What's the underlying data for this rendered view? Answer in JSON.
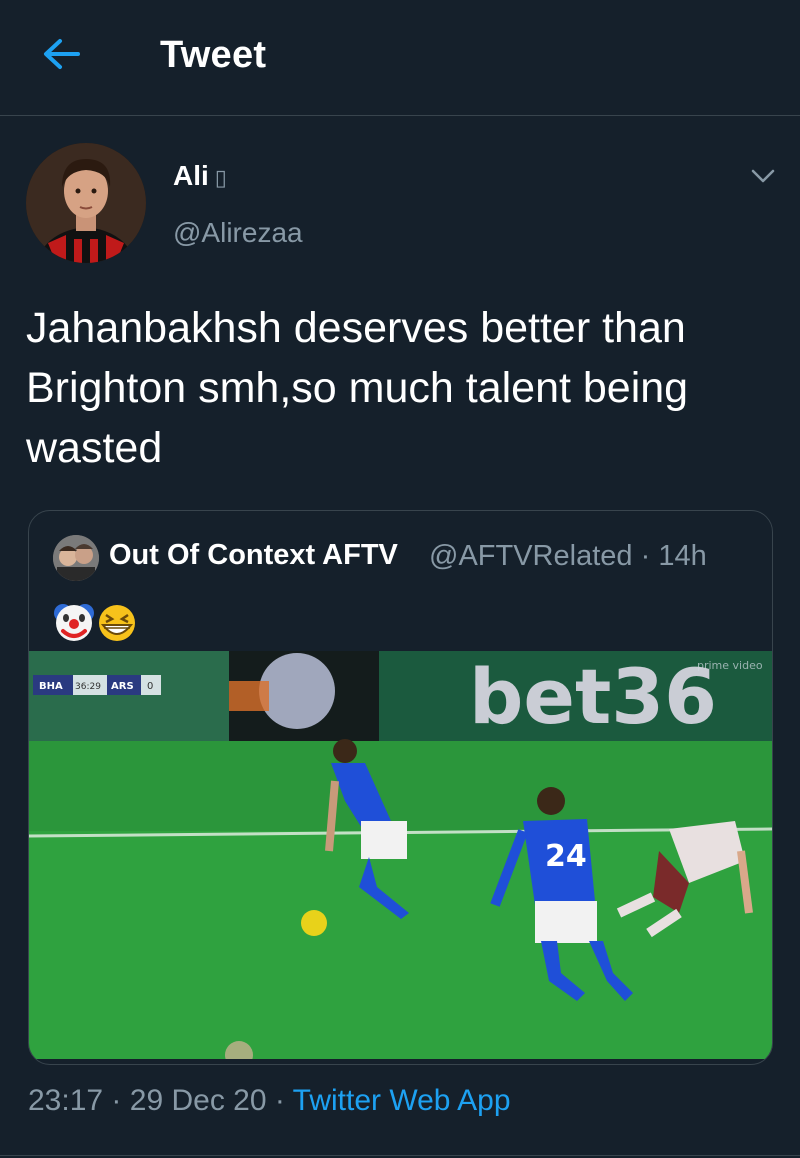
{
  "header": {
    "title": "Tweet",
    "back_icon": "arrow-left-icon",
    "accent_color": "#1da1f2"
  },
  "tweet": {
    "author": {
      "display_name": "Ali",
      "name_suffix": "▯",
      "handle": "@Alirezaa"
    },
    "text": "Jahanbakhsh deserves better than Brighton smh,so much talent being wasted",
    "timestamp_time": "23:17",
    "timestamp_date": "29 Dec 20",
    "source": "Twitter Web App",
    "separator": "·"
  },
  "quoted_tweet": {
    "author_name": "Out Of Context AFTV",
    "author_handle": "@AFTVRelated",
    "age": "14h",
    "emoji": [
      "clown-face",
      "grinning-squinting-face"
    ],
    "media": {
      "scoreboard_home": "BHA",
      "scoreboard_time": "36:29",
      "scoreboard_away": "ARS",
      "scoreboard_score": "0",
      "board_text": "bet36",
      "corner_watermark": "prime video",
      "player_number": "24"
    }
  },
  "colors": {
    "background": "#15202b",
    "text_secondary": "#8899a6",
    "border": "#38444d",
    "link": "#1da1f2"
  }
}
